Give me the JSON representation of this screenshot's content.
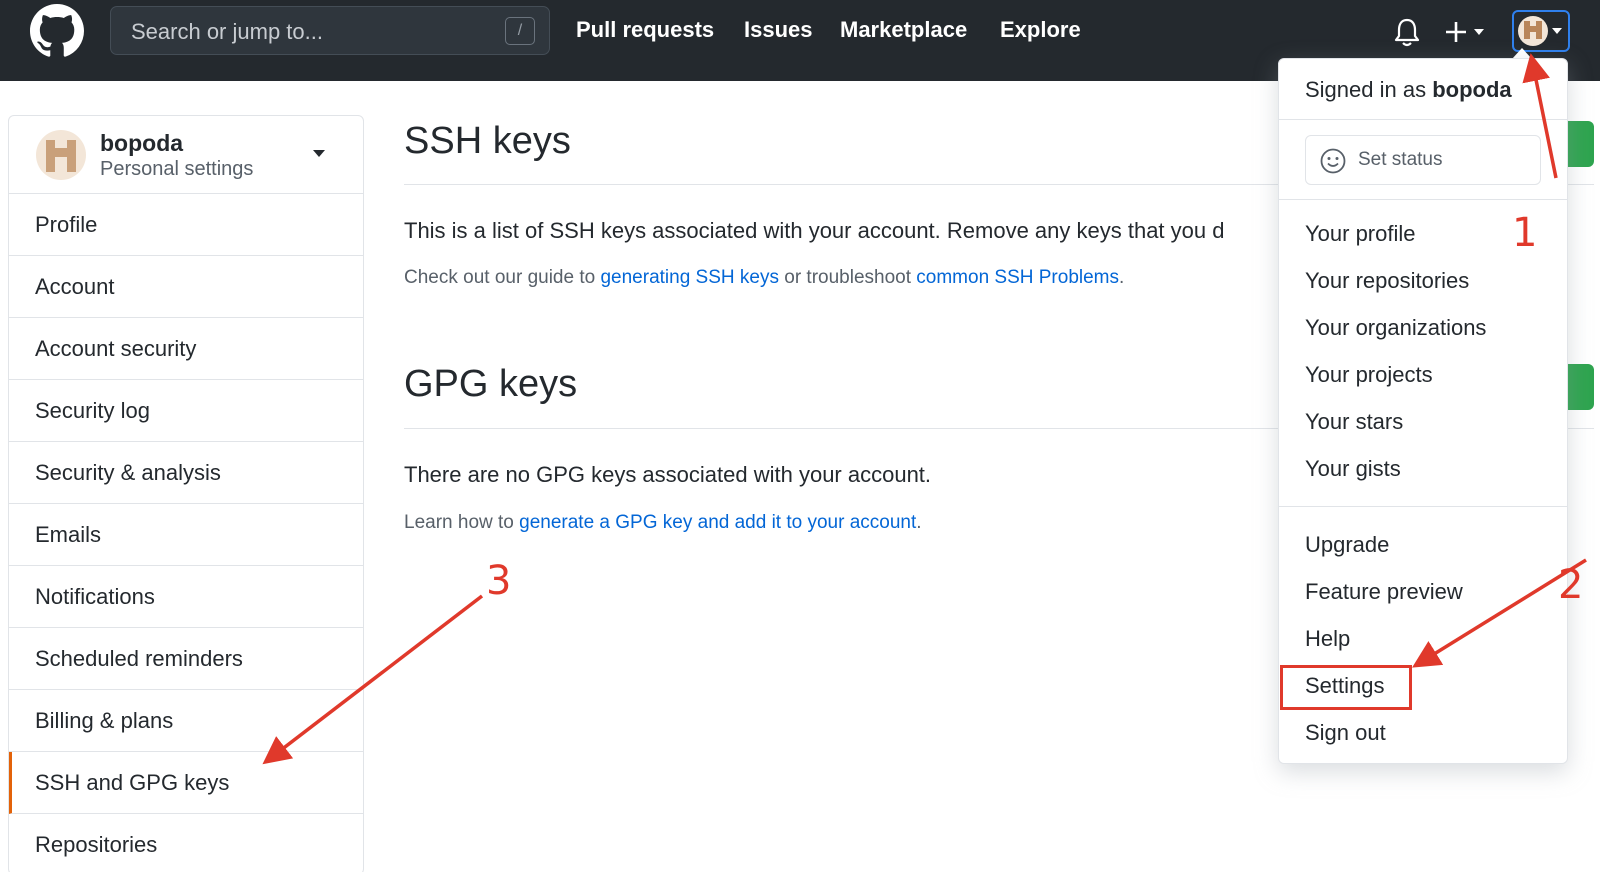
{
  "header": {
    "search_placeholder": "Search or jump to...",
    "search_shortcut": "/",
    "nav": [
      "Pull requests",
      "Issues",
      "Marketplace",
      "Explore"
    ]
  },
  "sidebar": {
    "username": "bopoda",
    "subtitle": "Personal settings",
    "items": [
      {
        "label": "Profile",
        "selected": false
      },
      {
        "label": "Account",
        "selected": false
      },
      {
        "label": "Account security",
        "selected": false
      },
      {
        "label": "Security log",
        "selected": false
      },
      {
        "label": "Security & analysis",
        "selected": false
      },
      {
        "label": "Emails",
        "selected": false
      },
      {
        "label": "Notifications",
        "selected": false
      },
      {
        "label": "Scheduled reminders",
        "selected": false
      },
      {
        "label": "Billing & plans",
        "selected": false
      },
      {
        "label": "SSH and GPG keys",
        "selected": true
      },
      {
        "label": "Repositories",
        "selected": false
      }
    ]
  },
  "main": {
    "ssh": {
      "title": "SSH keys",
      "text": "This is a list of SSH keys associated with your account. Remove any keys that you d",
      "note_prefix": "Check out our guide to ",
      "note_link1": "generating SSH keys",
      "note_mid": " or troubleshoot ",
      "note_link2": "common SSH Problems",
      "note_suffix": "."
    },
    "gpg": {
      "title": "GPG keys",
      "text": "There are no GPG keys associated with your account.",
      "note_prefix": "Learn how to ",
      "note_link": "generate a GPG key and add it to your account",
      "note_suffix": "."
    }
  },
  "dropdown": {
    "signed_prefix": "Signed in as ",
    "signed_user": "bopoda",
    "status_label": "Set status",
    "items": [
      "Your profile",
      "Your repositories",
      "Your organizations",
      "Your projects",
      "Your stars",
      "Your gists"
    ],
    "items2": [
      "Upgrade",
      "Feature preview",
      "Help",
      "Settings",
      "Sign out"
    ]
  },
  "annotations": {
    "color": "#e0392b",
    "labels": [
      "1",
      "2",
      "3"
    ]
  }
}
